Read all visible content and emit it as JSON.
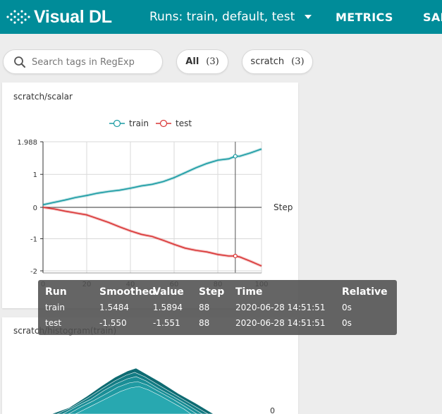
{
  "header": {
    "logo_text": "Visual DL",
    "runs_label": "Runs: train, default, test",
    "tabs": [
      "METRICS",
      "SAM"
    ],
    "colors": {
      "bar": "#008c99",
      "text": "#ffffff"
    }
  },
  "toolbar": {
    "search_placeholder": "Search tags in RegExp",
    "chips": [
      {
        "label": "All",
        "count": "(3)"
      },
      {
        "label": "scratch",
        "count": "(3)"
      }
    ]
  },
  "cards": [
    {
      "title": "scratch/scalar"
    },
    {
      "title": "scratch/histogram(train)"
    }
  ],
  "chart_data": {
    "type": "line",
    "title": "scratch/scalar",
    "xlabel": "Step",
    "ylabel": "",
    "xlim": [
      0,
      100
    ],
    "ylim": [
      -2.05,
      1.988
    ],
    "x_ticks": [
      "0",
      "20",
      "40",
      "60",
      "80",
      "100"
    ],
    "y_ticks": [
      {
        "value": 1.988,
        "label": "1.988"
      },
      {
        "value": 1,
        "label": "1"
      },
      {
        "value": 0,
        "label": "0"
      },
      {
        "value": -1,
        "label": "-1"
      },
      {
        "value": -2,
        "label": "-2"
      }
    ],
    "legend": {
      "placement": "top-center"
    },
    "grid": true,
    "hover_step": 88,
    "series": [
      {
        "name": "train",
        "color": "#1a9ba3",
        "points": [
          [
            0,
            0.08
          ],
          [
            5,
            0.15
          ],
          [
            10,
            0.22
          ],
          [
            15,
            0.3
          ],
          [
            20,
            0.36
          ],
          [
            25,
            0.43
          ],
          [
            30,
            0.48
          ],
          [
            35,
            0.52
          ],
          [
            40,
            0.58
          ],
          [
            45,
            0.65
          ],
          [
            50,
            0.7
          ],
          [
            55,
            0.78
          ],
          [
            60,
            0.9
          ],
          [
            65,
            1.05
          ],
          [
            70,
            1.2
          ],
          [
            75,
            1.33
          ],
          [
            80,
            1.43
          ],
          [
            85,
            1.47
          ],
          [
            88,
            1.5484
          ],
          [
            90,
            1.55
          ],
          [
            95,
            1.65
          ],
          [
            100,
            1.77
          ]
        ]
      },
      {
        "name": "test",
        "color": "#d93636",
        "points": [
          [
            0,
            0
          ],
          [
            5,
            -0.05
          ],
          [
            10,
            -0.12
          ],
          [
            15,
            -0.18
          ],
          [
            20,
            -0.24
          ],
          [
            25,
            -0.36
          ],
          [
            30,
            -0.48
          ],
          [
            35,
            -0.62
          ],
          [
            40,
            -0.75
          ],
          [
            45,
            -0.86
          ],
          [
            50,
            -0.93
          ],
          [
            55,
            -1.05
          ],
          [
            60,
            -1.18
          ],
          [
            65,
            -1.3
          ],
          [
            70,
            -1.37
          ],
          [
            75,
            -1.42
          ],
          [
            80,
            -1.5
          ],
          [
            85,
            -1.55
          ],
          [
            88,
            -1.55
          ],
          [
            90,
            -1.58
          ],
          [
            95,
            -1.72
          ],
          [
            100,
            -1.87
          ]
        ]
      }
    ]
  },
  "tooltip": {
    "headers": [
      "Run",
      "Smoothed",
      "Value",
      "Step",
      "Time",
      "Relative"
    ],
    "rows": [
      {
        "run": "train",
        "smoothed": "1.5484",
        "value": "1.5894",
        "step": "88",
        "time": "2020-06-28 14:51:51",
        "relative": "0s"
      },
      {
        "run": "test",
        "smoothed": "-1.550",
        "value": "-1.551",
        "step": "88",
        "time": "2020-06-28 14:51:51",
        "relative": "0s"
      }
    ]
  },
  "histogram_axis_label": "0"
}
